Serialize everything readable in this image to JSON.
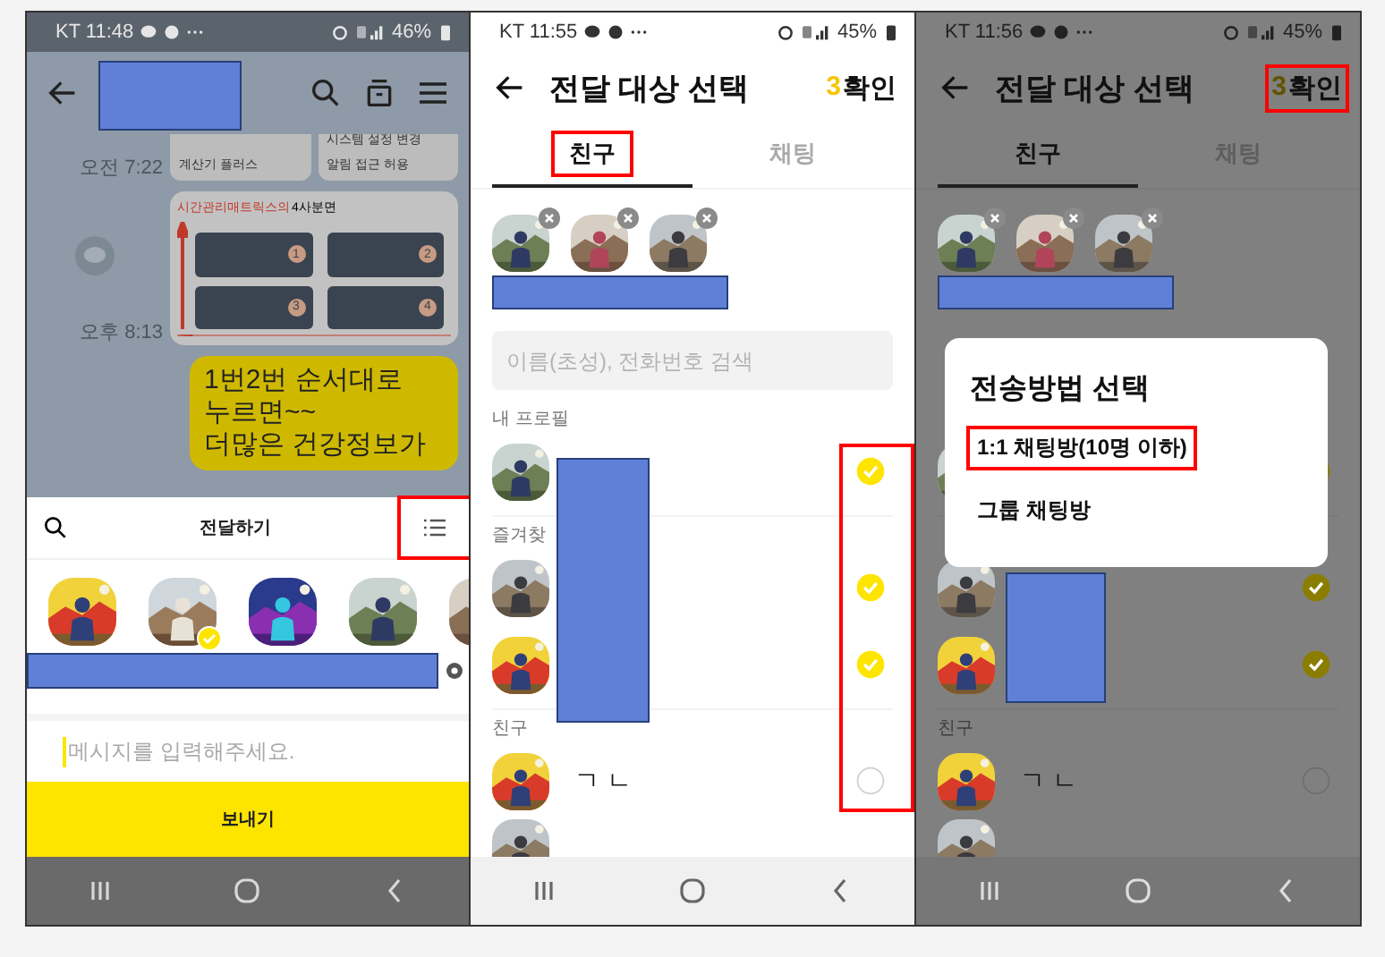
{
  "chat_screen": {
    "status_bar": {
      "time": "KT 11:48",
      "battery": "46%"
    },
    "chat": {
      "times": [
        "오전 7:22",
        "오후 8:13"
      ],
      "settings_card": {
        "left_item": "계산기 플러스",
        "right_items": [
          "시스템 설정 변경",
          "알림 접근 허용"
        ]
      },
      "matrix_card": {
        "title": "시간관리매트릭스의",
        "title_suffix": "4사분면",
        "quadrants": [
          "1",
          "2",
          "3",
          "4"
        ]
      },
      "bubble": "1번2번 순서대로\n누르면~~\n더많은 건강정보가"
    },
    "share_sheet": {
      "title": "전달하기",
      "menu_highlighted": true,
      "friends": [
        {
          "selected": false
        },
        {
          "selected": true
        },
        {
          "selected": false
        },
        {
          "selected": false
        },
        {
          "selected": false
        }
      ],
      "message_placeholder": "메시지를 입력해주세요.",
      "send": "보내기"
    }
  },
  "select_screen": {
    "status_bar": {
      "time": "KT 11:55",
      "battery": "45%"
    },
    "title": "전달 대상 선택",
    "count": "3",
    "confirm": "확인",
    "confirm_highlighted": false,
    "tabs": [
      {
        "label": "친구",
        "selected": true,
        "highlighted": true
      },
      {
        "label": "채팅",
        "selected": false,
        "highlighted": false
      }
    ],
    "search": {
      "placeholder": "이름(초성), 전화번호 검색"
    },
    "checks_highlighted": true,
    "sections": [
      {
        "label": "내 프로필",
        "rows": [
          {
            "checked": true
          }
        ]
      },
      {
        "label": "즐겨찾",
        "rows": [
          {
            "checked": true
          },
          {
            "checked": true
          }
        ]
      },
      {
        "label": "친구",
        "rows": [
          {
            "name": "ㄱ ㄴ",
            "checked": false
          }
        ]
      }
    ]
  },
  "method_screen": {
    "status_bar": {
      "time": "KT 11:56",
      "battery": "45%"
    },
    "title": "전달 대상 선택",
    "count": "3",
    "confirm": "확인",
    "confirm_highlighted": true,
    "tabs": [
      {
        "label": "친구",
        "selected": true,
        "highlighted": false
      },
      {
        "label": "채팅",
        "selected": false,
        "highlighted": false
      }
    ],
    "checks_highlighted": false,
    "sections": [
      {
        "rows": [
          {
            "checked": true
          }
        ]
      },
      {
        "rows": [
          {
            "checked": true
          },
          {
            "checked": true
          }
        ]
      },
      {
        "label": "친구",
        "rows": [
          {
            "name": "ㄱ ㄴ",
            "checked": false
          }
        ]
      }
    ],
    "dialog": {
      "title": "전송방법 선택",
      "options": [
        {
          "label": "1:1 채팅방(10명 이하)",
          "highlighted": true
        },
        {
          "label": "그룹 채팅방",
          "highlighted": false
        }
      ]
    }
  }
}
